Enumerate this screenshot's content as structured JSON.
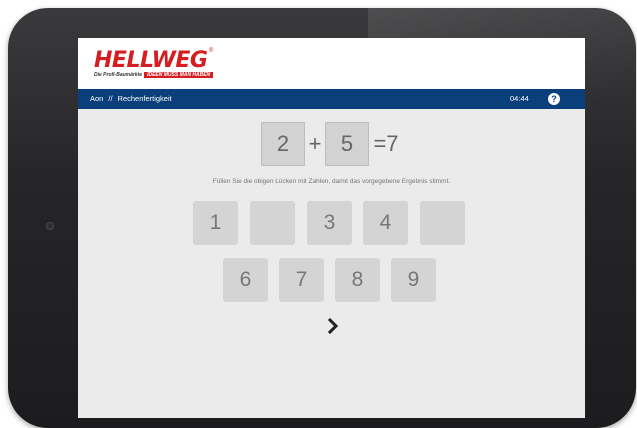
{
  "brand": {
    "name": "HELLWEG",
    "tagline_small": "Die Profi-Baumärkte",
    "tagline": "IDEEN MUSS MAN HABEN",
    "color": "#d51e22"
  },
  "navbar": {
    "crumb_first": "Aon",
    "separator": "//",
    "crumb_second": "Rechenfertigkeit",
    "timer": "04:44",
    "help_icon": "?",
    "color": "#0a3f7c"
  },
  "equation": {
    "left": "2",
    "operator": "+",
    "right": "5",
    "result": "=7"
  },
  "instruction": "Füllen Sie die obigen Lücken mit Zahlen, damit das vorgegebene Ergebnis stimmt.",
  "keypad": {
    "row1": [
      "1",
      "",
      "3",
      "4",
      ""
    ],
    "row2": [
      "6",
      "7",
      "8",
      "9"
    ]
  },
  "next_icon": "chevron-right-icon"
}
